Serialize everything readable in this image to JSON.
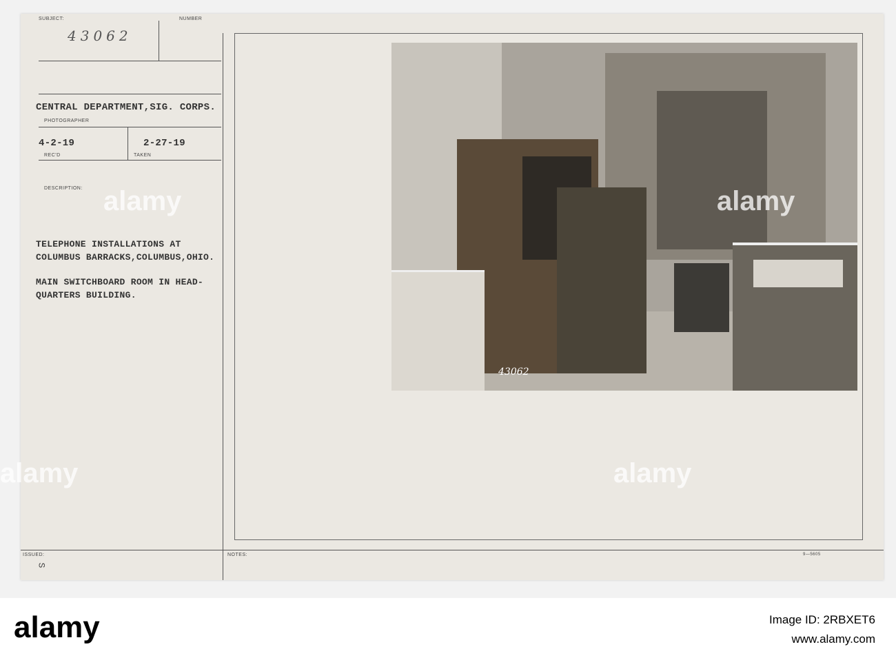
{
  "card": {
    "subject_label": "SUBJECT:",
    "subject_number": "43062",
    "number_label": "NUMBER",
    "photographer": "CENTRAL DEPARTMENT,SIG. CORPS.",
    "photographer_label": "PHOTOGRAPHER",
    "recd": "4-2-19",
    "recd_label": "REC'D",
    "taken": "2-27-19",
    "taken_label": "TAKEN",
    "description_label": "DESCRIPTION:",
    "description_1": "TELEPHONE INSTALLATIONS AT\nCOLUMBUS BARRACKS,COLUMBUS,OHIO.",
    "description_2": "MAIN SWITCHBOARD ROOM IN HEAD-\nQUARTERS BUILDING.",
    "issued_label": "ISSUED:",
    "issued_mark": "S",
    "notes_label": "NOTES:",
    "form_number": "9—5605"
  },
  "photo": {
    "negative_number": "43062"
  },
  "watermark": "alamy",
  "banner": {
    "logo": "alamy",
    "image_id": "Image ID: 2RBXET6",
    "url": "www.alamy.com"
  }
}
